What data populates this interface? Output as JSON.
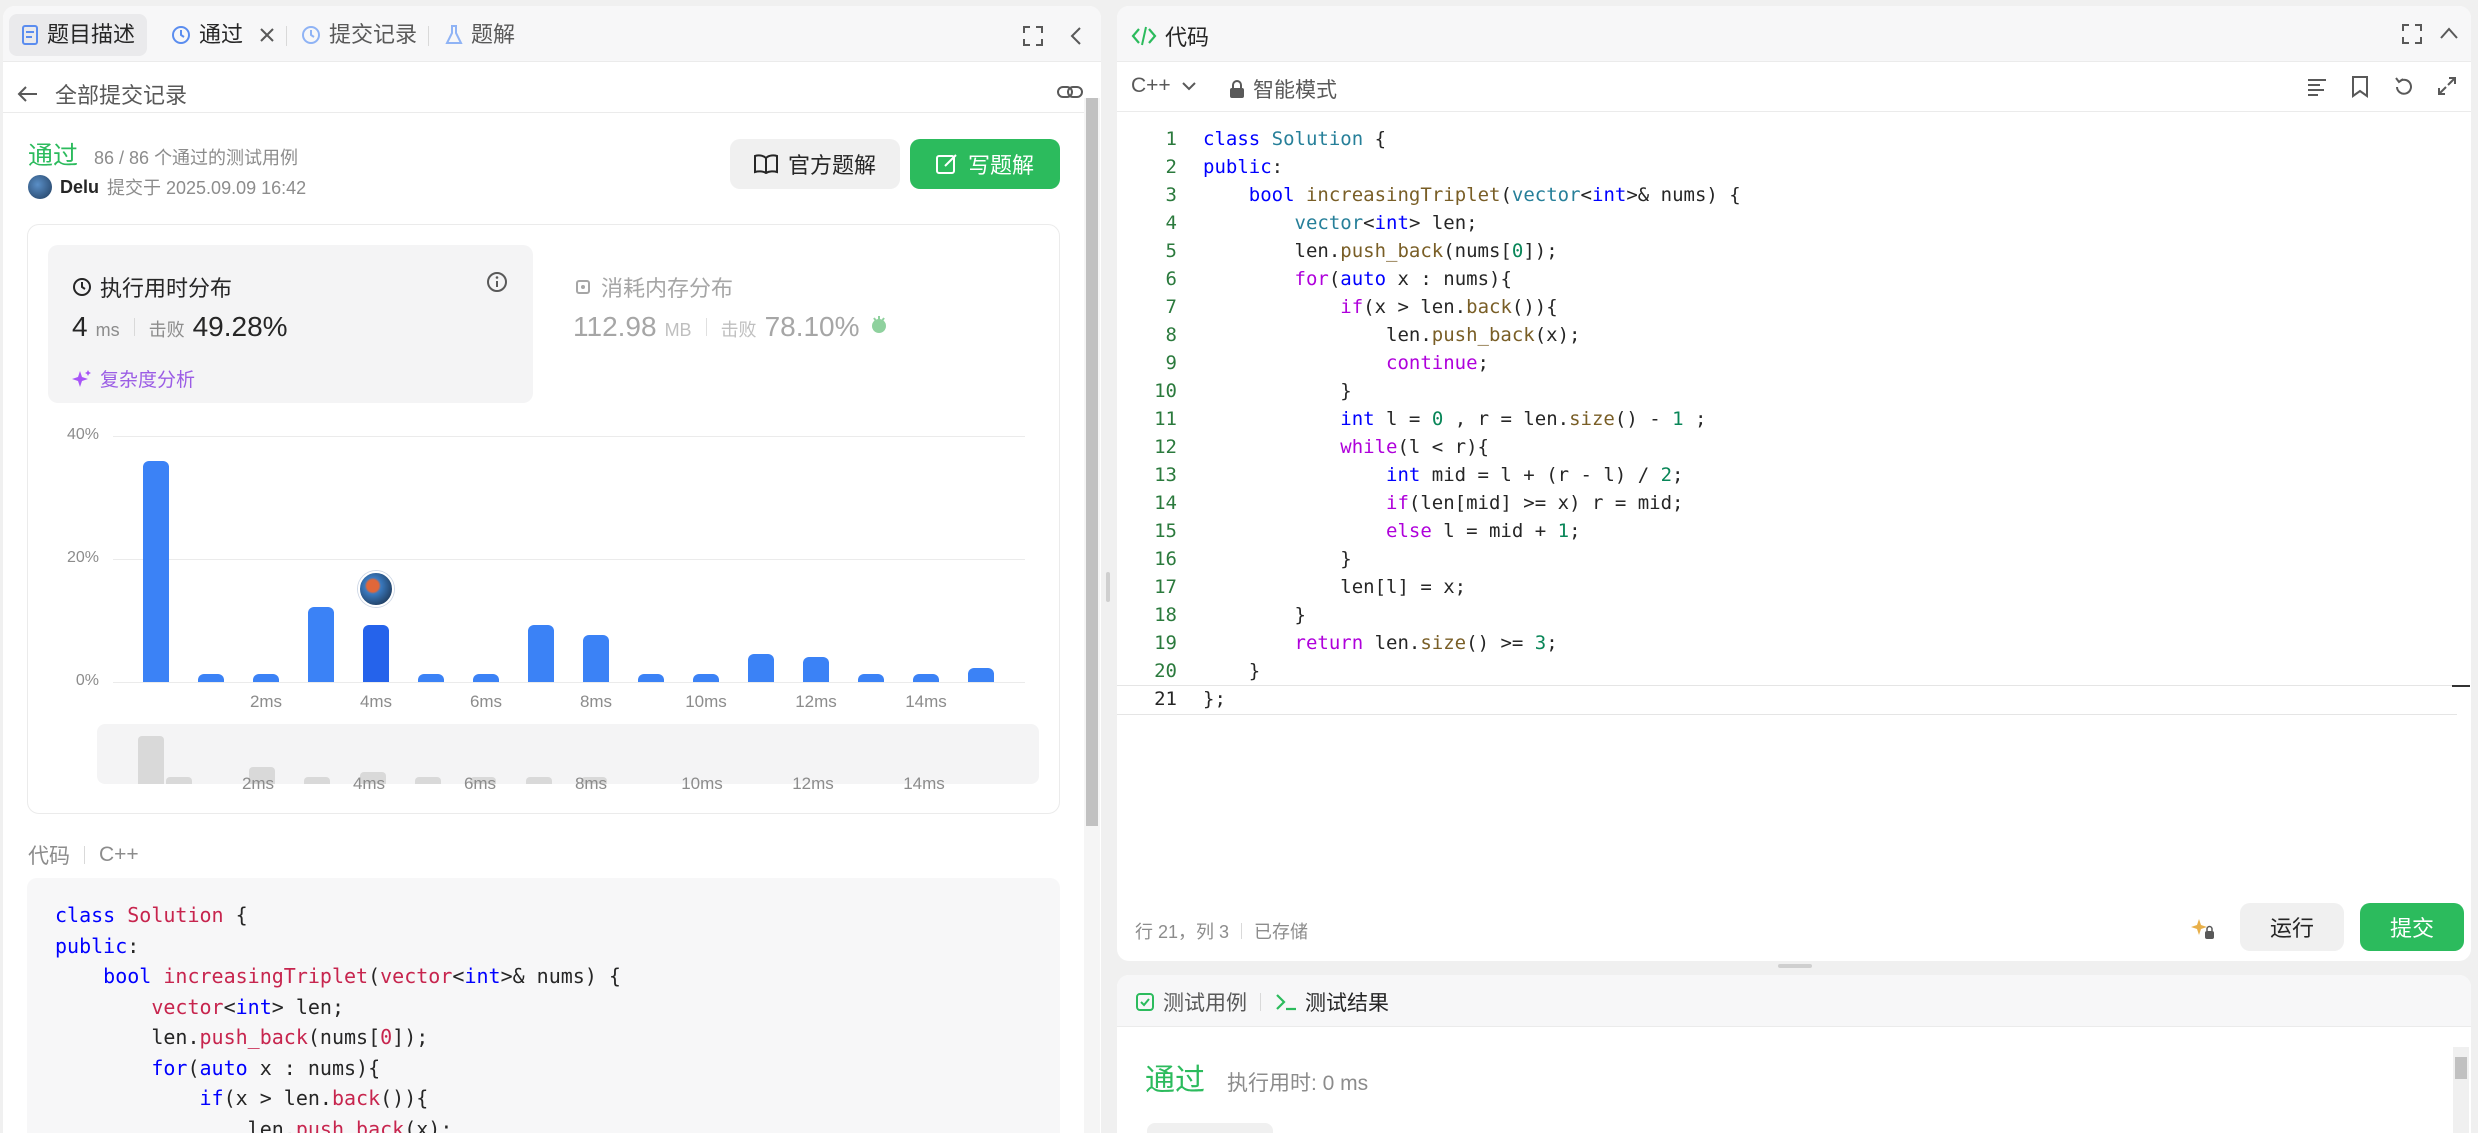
{
  "left_tabs": {
    "description": "题目描述",
    "passed": "通过",
    "submissions": "提交记录",
    "solutions": "题解"
  },
  "back_link": "全部提交记录",
  "result": {
    "status": "通过",
    "cases": "86 / 86 个通过的测试用例",
    "user": "Delu",
    "submitted_at": "提交于 2025.09.09 16:42"
  },
  "buttons": {
    "official": "官方题解",
    "write": "写题解",
    "run": "运行",
    "submit": "提交"
  },
  "runtime": {
    "title": "执行用时分布",
    "value": "4",
    "unit": "ms",
    "beat_label": "击败",
    "beat": "49.28%",
    "analysis": "复杂度分析"
  },
  "memory": {
    "title": "消耗内存分布",
    "value": "112.98",
    "unit": "MB",
    "beat_label": "击败",
    "beat": "78.10%"
  },
  "chart_data": {
    "type": "bar",
    "y_ticks": [
      "40%",
      "20%",
      "0%"
    ],
    "ylim": [
      0,
      40
    ],
    "x_tick_labels": [
      "2ms",
      "4ms",
      "6ms",
      "8ms",
      "10ms",
      "12ms",
      "14ms"
    ],
    "x": [
      0,
      1,
      2,
      3,
      4,
      5,
      6,
      7,
      8,
      9,
      10,
      11,
      12,
      13,
      14,
      15,
      16
    ],
    "values": [
      36,
      1.3,
      1.3,
      12.2,
      9.2,
      1.3,
      1.3,
      9.2,
      7.7,
      1.3,
      1.3,
      4.5,
      4.1,
      1.3,
      1.3,
      2.3,
      0
    ],
    "highlight_index": 4,
    "mini_values": [
      8,
      1.2,
      0,
      0,
      2.8,
      0,
      1.2,
      0,
      2,
      0,
      1.2,
      0,
      1.2,
      0,
      1.2,
      0,
      1.2
    ],
    "mini_labels": [
      "2ms",
      "4ms",
      "6ms",
      "8ms",
      "10ms",
      "12ms",
      "14ms"
    ]
  },
  "code_section": {
    "label": "代码",
    "lang": "C++"
  },
  "editor": {
    "title": "代码",
    "lang": "C++",
    "mode": "智能模式",
    "status_pos": "行 21，列 3",
    "status_saved": "已存储",
    "lines": [
      "class Solution {",
      "public:",
      "    bool increasingTriplet(vector<int>& nums) {",
      "        vector<int> len;",
      "        len.push_back(nums[0]);",
      "        for(auto x : nums){",
      "            if(x > len.back()){",
      "                len.push_back(x);",
      "                continue;",
      "            }",
      "            int l = 0 , r = len.size() - 1 ;",
      "            while(l < r){",
      "                int mid = l + (r - l) / 2;",
      "                if(len[mid] >= x) r = mid;",
      "                else l = mid + 1;",
      "            }",
      "            len[l] = x;",
      "        }",
      "        return len.size() >= 3;",
      "    }",
      "};"
    ]
  },
  "bottom": {
    "tab_cases": "测试用例",
    "tab_results": "测试结果",
    "status": "通过",
    "runtime": "执行用时: 0 ms"
  },
  "colors": {
    "accent_green": "#2cbb5d",
    "bar_blue": "#3b82f6",
    "purple": "#a855f7"
  }
}
